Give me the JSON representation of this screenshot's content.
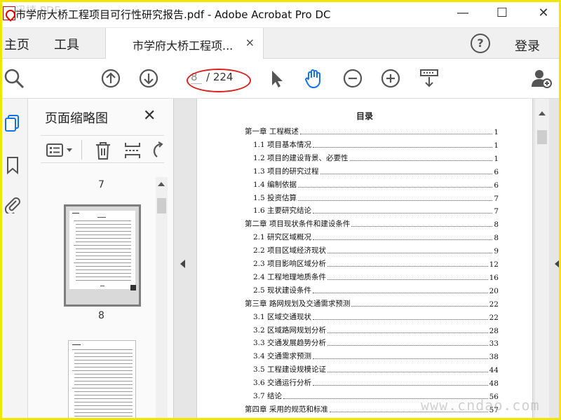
{
  "window": {
    "title": "市学府大桥工程项目可行性研究报告.pdf - Adobe Acrobat Pro DC",
    "minimize": "—",
    "maximize": "☐",
    "close": "✕"
  },
  "tabbar": {
    "home": "主页",
    "tools": "工具",
    "doc_tab": "市学府大桥工程项...",
    "doc_tab_close": "×",
    "help": "?",
    "login": "登录"
  },
  "toolbar": {
    "current_page": "8",
    "page_total": "/ 224"
  },
  "panel": {
    "title": "页面缩略图",
    "close": "✕",
    "thumbs": [
      {
        "label": "7"
      },
      {
        "label": "8"
      }
    ]
  },
  "toc": {
    "title": "目录",
    "rows": [
      {
        "text": "第一章  工程概述",
        "page": "1",
        "level": 0
      },
      {
        "text": "1.1 项目基本情况",
        "page": "1",
        "level": 1
      },
      {
        "text": "1.2  项目的建设背景、必要性",
        "page": "1",
        "level": 1
      },
      {
        "text": "1.3  项目的研究过程",
        "page": "6",
        "level": 1
      },
      {
        "text": "1.4  编制依据",
        "page": "6",
        "level": 1
      },
      {
        "text": "1.5 投资估算",
        "page": "7",
        "level": 1
      },
      {
        "text": "1.6 主要研究结论",
        "page": "7",
        "level": 1
      },
      {
        "text": "第二章    项目现状条件和建设条件",
        "page": "8",
        "level": 0
      },
      {
        "text": "2.1  研究区域概况",
        "page": "8",
        "level": 1
      },
      {
        "text": "2.2 项目区域经济现状",
        "page": "9",
        "level": 1
      },
      {
        "text": "2.3 项目影响区域分析",
        "page": "12",
        "level": 1
      },
      {
        "text": "2.4 工程地理地质条件",
        "page": "16",
        "level": 1
      },
      {
        "text": "2.5  现状建设条件",
        "page": "20",
        "level": 1
      },
      {
        "text": "第三章  路网规划及交通需求预测",
        "page": "22",
        "level": 0
      },
      {
        "text": "3.1 区域交通现状",
        "page": "22",
        "level": 1
      },
      {
        "text": "3.2 区域路网规划分析",
        "page": "28",
        "level": 1
      },
      {
        "text": "3.3  交通发展趋势分析",
        "page": "33",
        "level": 1
      },
      {
        "text": "3.4 交通需求预测",
        "page": "38",
        "level": 1
      },
      {
        "text": "3.5 工程建设规模论证",
        "page": "44",
        "level": 1
      },
      {
        "text": "3.6 交通运行分析",
        "page": "48",
        "level": 1
      },
      {
        "text": "3.7 结论",
        "page": "56",
        "level": 1
      },
      {
        "text": "第四章    采用的规范和标准",
        "page": "57",
        "level": 0
      }
    ]
  },
  "watermark": {
    "top_left": "迅捷·PDF",
    "bottom_right": "www.cndao.com"
  },
  "colors": {
    "frame": "#f2e600",
    "annotation_ring": "#d8231f",
    "hand_tool_active": "#1473e6"
  }
}
